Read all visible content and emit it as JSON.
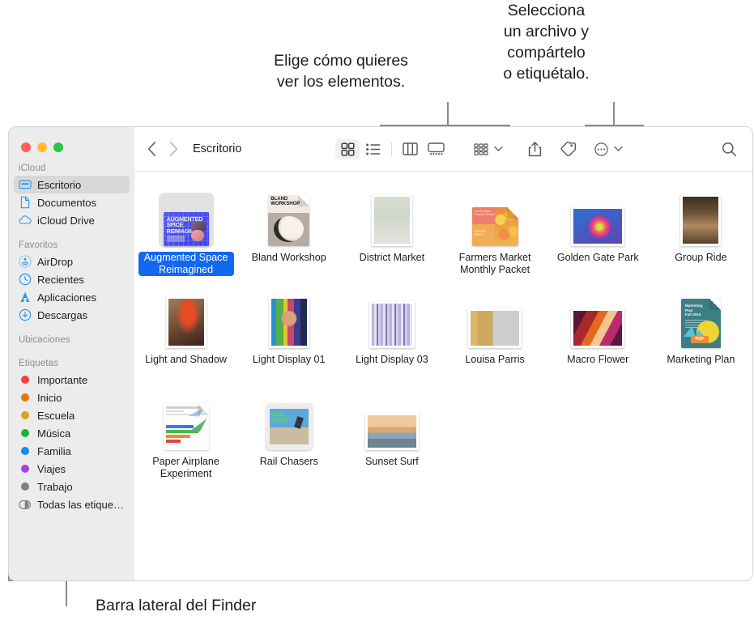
{
  "callouts": {
    "views": "Elige cómo quieres\nver los elementos.",
    "share": "Selecciona\nun archivo y\ncompártelo\no etiquétalo.",
    "sidebar": "Barra lateral del Finder"
  },
  "window": {
    "traffic_lights": [
      "close",
      "minimize",
      "zoom"
    ]
  },
  "sidebar": {
    "sections": [
      {
        "header": "iCloud",
        "items": [
          {
            "label": "Escritorio",
            "icon": "desktop-icon",
            "selected": true
          },
          {
            "label": "Documentos",
            "icon": "document-icon",
            "selected": false
          },
          {
            "label": "iCloud Drive",
            "icon": "cloud-icon",
            "selected": false
          }
        ]
      },
      {
        "header": "Favoritos",
        "items": [
          {
            "label": "AirDrop",
            "icon": "airdrop-icon",
            "selected": false
          },
          {
            "label": "Recientes",
            "icon": "clock-icon",
            "selected": false
          },
          {
            "label": "Aplicaciones",
            "icon": "applications-icon",
            "selected": false
          },
          {
            "label": "Descargas",
            "icon": "downloads-icon",
            "selected": false
          }
        ]
      },
      {
        "header": "Ubicaciones",
        "items": []
      },
      {
        "header": "Etiquetas",
        "items": [
          {
            "label": "Importante",
            "icon": "tag-dot-icon",
            "color": "#f9423a",
            "selected": false
          },
          {
            "label": "Inicio",
            "icon": "tag-dot-icon",
            "color": "#e8720c",
            "selected": false
          },
          {
            "label": "Escuela",
            "icon": "tag-dot-icon",
            "color": "#d9a420",
            "selected": false
          },
          {
            "label": "Música",
            "icon": "tag-dot-icon",
            "color": "#19b43a",
            "selected": false
          },
          {
            "label": "Familia",
            "icon": "tag-dot-icon",
            "color": "#1787f5",
            "selected": false
          },
          {
            "label": "Viajes",
            "icon": "tag-dot-icon",
            "color": "#a843e0",
            "selected": false
          },
          {
            "label": "Trabajo",
            "icon": "tag-dot-icon",
            "color": "#7f7f85",
            "selected": false
          },
          {
            "label": "Todas las etique…",
            "icon": "all-tags-icon",
            "color": "",
            "selected": false
          }
        ]
      }
    ]
  },
  "toolbar": {
    "back_icon": "chevron-left-icon",
    "forward_icon": "chevron-right-icon",
    "path": "Escritorio",
    "view_buttons": [
      {
        "name": "icon-view-button",
        "icon": "grid-view-icon",
        "active": true
      },
      {
        "name": "list-view-button",
        "icon": "list-view-icon",
        "active": false
      },
      {
        "name": "column-view-button",
        "icon": "column-view-icon",
        "active": false
      },
      {
        "name": "gallery-view-button",
        "icon": "gallery-view-icon",
        "active": false
      }
    ],
    "group_button": {
      "name": "group-by-button",
      "icon": "group-icon"
    },
    "share_button": {
      "name": "share-button",
      "icon": "share-icon"
    },
    "tag_button": {
      "name": "tag-button",
      "icon": "tag-icon"
    },
    "more_button": {
      "name": "more-actions-button",
      "icon": "ellipsis-circle-icon"
    },
    "search_button": {
      "name": "search-button",
      "icon": "search-icon"
    }
  },
  "files": [
    {
      "name": "Augmented Space Reimagined",
      "kind": "keynote",
      "selected": true
    },
    {
      "name": "Bland Workshop",
      "kind": "pages-doc",
      "selected": false
    },
    {
      "name": "District Market",
      "kind": "photo-portrait",
      "selected": false
    },
    {
      "name": "Farmers Market Monthly Packet",
      "kind": "pdf-doc",
      "selected": false
    },
    {
      "name": "Golden Gate Park",
      "kind": "photo-landscape",
      "selected": false
    },
    {
      "name": "Group Ride",
      "kind": "photo-portrait",
      "selected": false
    },
    {
      "name": "Light and Shadow",
      "kind": "photo-portrait",
      "selected": false
    },
    {
      "name": "Light Display 01",
      "kind": "photo-portrait",
      "selected": false
    },
    {
      "name": "Light Display 03",
      "kind": "photo-portrait",
      "selected": false
    },
    {
      "name": "Louisa Parris",
      "kind": "photo-landscape",
      "selected": false
    },
    {
      "name": "Macro Flower",
      "kind": "photo-landscape",
      "selected": false
    },
    {
      "name": "Marketing Plan",
      "kind": "pdf-doc",
      "selected": false
    },
    {
      "name": "Paper Airplane Experiment",
      "kind": "pages-doc",
      "selected": false
    },
    {
      "name": "Rail Chasers",
      "kind": "photo-square",
      "selected": false
    },
    {
      "name": "Sunset Surf",
      "kind": "photo-landscape",
      "selected": false
    }
  ],
  "colors": {
    "selection_blue": "#1268ef",
    "sidebar_bg": "#ececec",
    "sidebar_selected": "#d8d8d8",
    "leader_line": "#8b8b8b"
  }
}
